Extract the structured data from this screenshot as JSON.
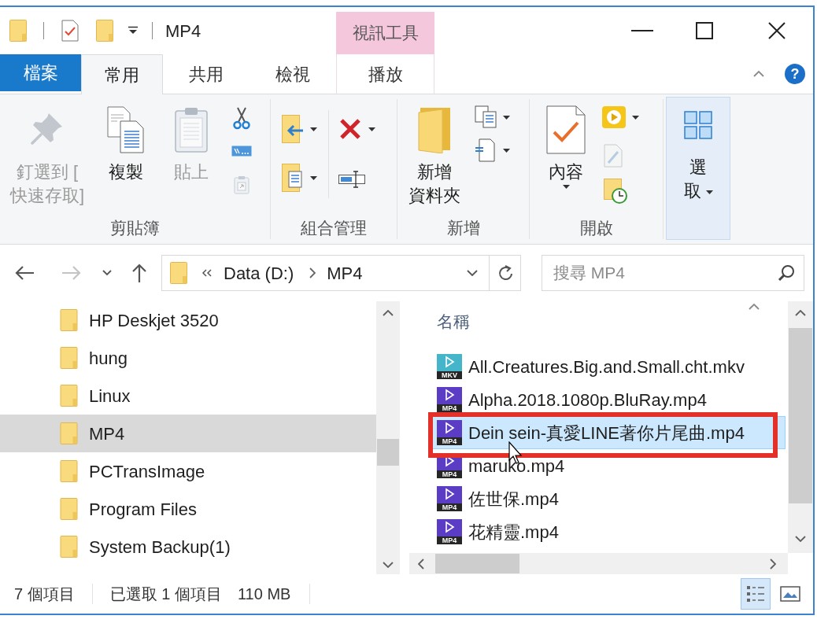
{
  "title_bar": {
    "title": "MP4",
    "contextual_group": "視訊工具"
  },
  "ribbon_tabs": [
    {
      "label": "檔案",
      "kind": "file",
      "selected": false
    },
    {
      "label": "常用",
      "kind": "standard",
      "selected": true
    },
    {
      "label": "共用",
      "kind": "standard",
      "selected": false
    },
    {
      "label": "檢視",
      "kind": "standard",
      "selected": false
    },
    {
      "label": "播放",
      "kind": "contextual",
      "selected": false
    }
  ],
  "help": "?",
  "ribbon": {
    "groups": [
      {
        "label": "剪貼簿",
        "commands": [
          {
            "lines": [
              "釘選到 [",
              "快速存取]"
            ],
            "disabled": true
          },
          {
            "lines": [
              "複製"
            ],
            "disabled": false
          },
          {
            "lines": [
              "貼上"
            ],
            "disabled": true
          }
        ],
        "icon_commands": [
          {
            "disabled": false
          },
          {
            "disabled": false
          },
          {
            "disabled": true
          }
        ]
      },
      {
        "label": "組合管理"
      },
      {
        "label": "新增",
        "commands": [
          {
            "lines": [
              "新增",
              "資料夾"
            ]
          }
        ]
      },
      {
        "label": "開啟",
        "commands": [
          {
            "lines": [
              "內容"
            ]
          }
        ],
        "icon_commands": [
          {
            "disabled": false
          },
          {
            "disabled": true
          },
          {
            "disabled": false
          }
        ]
      },
      {
        "commands": [
          {
            "lines": [
              "選",
              "取"
            ],
            "highlighted": true
          }
        ]
      }
    ]
  },
  "nav_buttons": [
    {
      "disabled": false
    },
    {
      "disabled": true
    },
    {
      "disabled": false
    },
    {
      "disabled": false
    }
  ],
  "address_bar": {
    "path": [
      "Data (D:)",
      "MP4"
    ]
  },
  "search": {
    "placeholder": "搜尋 MP4"
  },
  "navigation_pane": {
    "items": [
      {
        "label": "HP Deskjet 3520",
        "selected": false
      },
      {
        "label": "hung",
        "selected": false
      },
      {
        "label": "Linux",
        "selected": false
      },
      {
        "label": "MP4",
        "selected": true
      },
      {
        "label": "PCTransImage",
        "selected": false
      },
      {
        "label": "Program Files",
        "selected": false
      },
      {
        "label": "System Backup(1)",
        "selected": false
      }
    ]
  },
  "file_list": {
    "column": "名稱",
    "files": [
      {
        "name": "All.Creatures.Big.and.Small.cht.mkv",
        "type_label": "MKV",
        "color": "#45b5c9",
        "selected": false,
        "annotated": false
      },
      {
        "name": "Alpha.2018.1080p.BluRay.mp4",
        "type_label": "MP4",
        "color": "#5b3cc4",
        "selected": false,
        "annotated": false
      },
      {
        "name": "Dein sein-真愛LINE著你片尾曲.mp4",
        "type_label": "MP4",
        "color": "#5b3cc4",
        "selected": true,
        "annotated": true
      },
      {
        "name": "maruko.mp4",
        "type_label": "MP4",
        "color": "#5b3cc4",
        "selected": false,
        "annotated": false
      },
      {
        "name": "佐世保.mp4",
        "type_label": "MP4",
        "color": "#5b3cc4",
        "selected": false,
        "annotated": false
      },
      {
        "name": "花精靈.mp4",
        "type_label": "MP4",
        "color": "#5b3cc4",
        "selected": false,
        "annotated": false
      }
    ]
  },
  "status_bar": {
    "item_count": "7 個項目",
    "selection": "已選取 1 個項目",
    "selection_size": "110 MB",
    "views": [
      {
        "selected": true
      },
      {
        "selected": false
      }
    ]
  }
}
